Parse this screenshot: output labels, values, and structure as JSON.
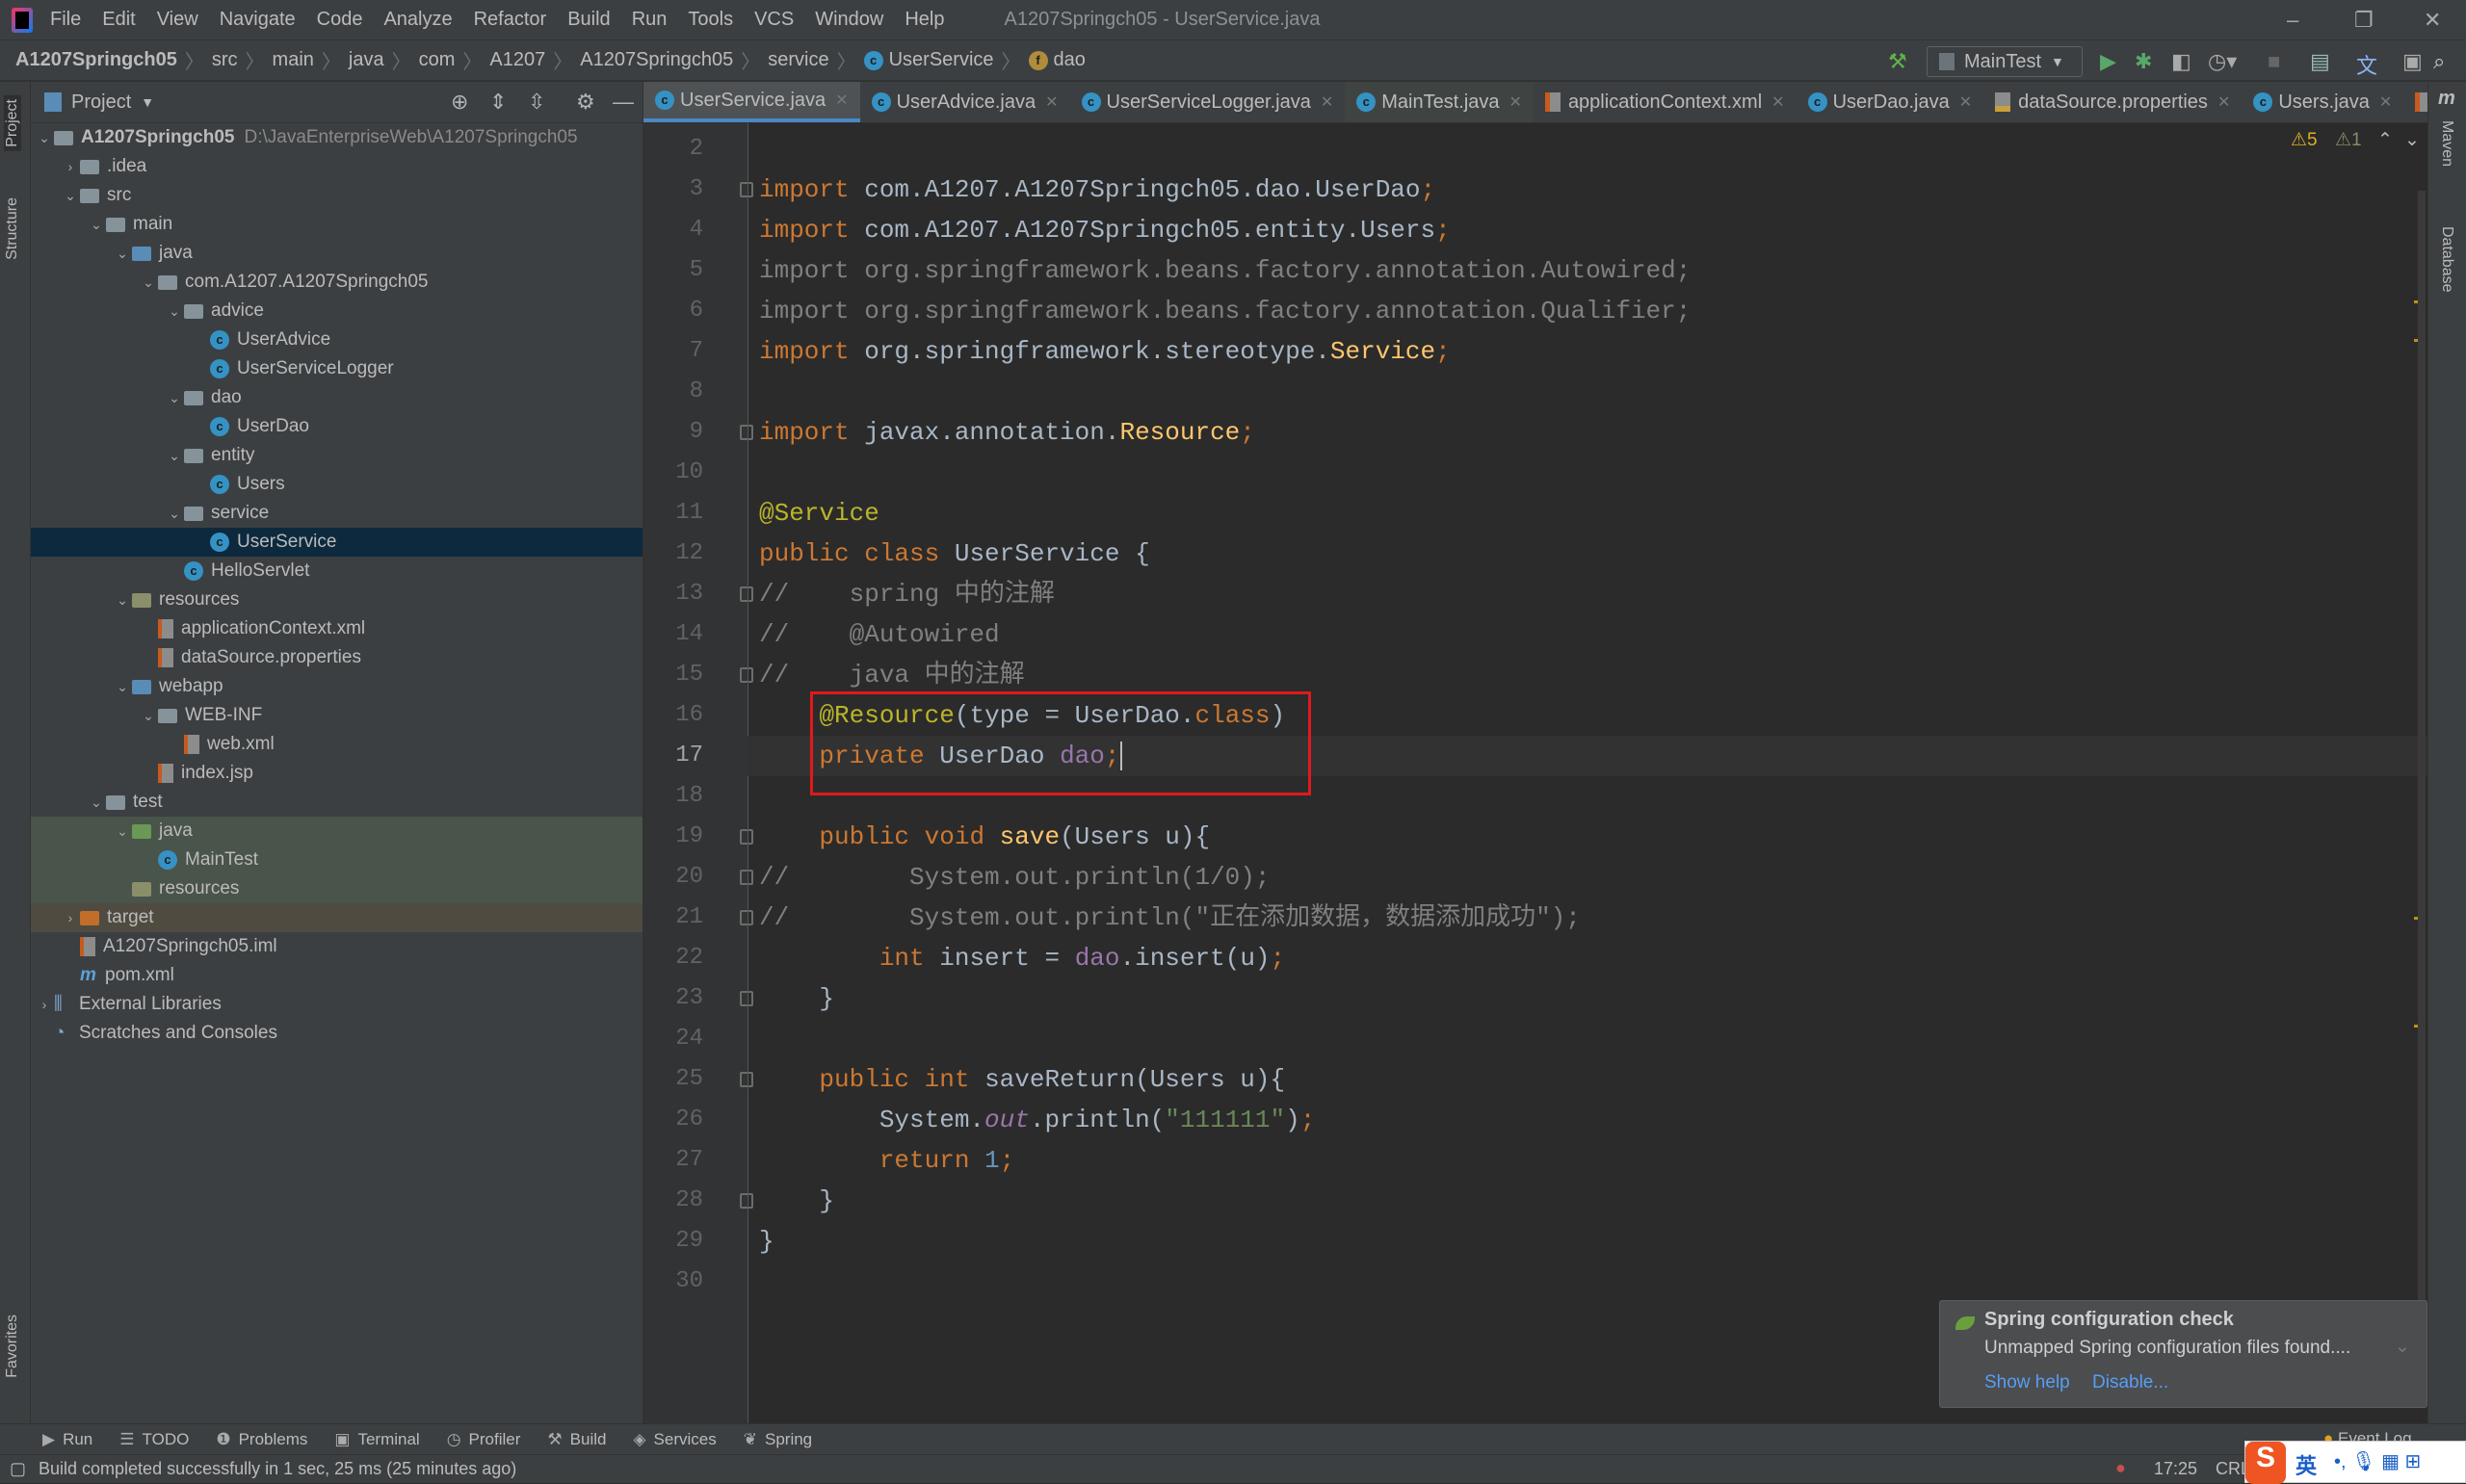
{
  "menubar": {
    "items": [
      "File",
      "Edit",
      "View",
      "Navigate",
      "Code",
      "Analyze",
      "Refactor",
      "Build",
      "Run",
      "Tools",
      "VCS",
      "Window",
      "Help"
    ],
    "title": "A1207Springch05 - UserService.java"
  },
  "navbar": {
    "crumbs": [
      "A1207Springch05",
      "src",
      "main",
      "java",
      "com",
      "A1207",
      "A1207Springch05",
      "service",
      "UserService",
      "dao"
    ],
    "run_config": "MainTest"
  },
  "project": {
    "title": "Project",
    "tree": [
      {
        "label": "A1207Springch05",
        "path": "D:\\JavaEnterpriseWeb\\A1207Springch05",
        "depth": 0,
        "arrow": "v",
        "icon": "folder"
      },
      {
        "label": ".idea",
        "depth": 1,
        "arrow": ">",
        "icon": "folder"
      },
      {
        "label": "src",
        "depth": 1,
        "arrow": "v",
        "icon": "folder"
      },
      {
        "label": "main",
        "depth": 2,
        "arrow": "v",
        "icon": "folder"
      },
      {
        "label": "java",
        "depth": 3,
        "arrow": "v",
        "icon": "folder-blue"
      },
      {
        "label": "com.A1207.A1207Springch05",
        "depth": 4,
        "arrow": "v",
        "icon": "package"
      },
      {
        "label": "advice",
        "depth": 5,
        "arrow": "v",
        "icon": "package"
      },
      {
        "label": "UserAdvice",
        "depth": 6,
        "icon": "class"
      },
      {
        "label": "UserServiceLogger",
        "depth": 6,
        "icon": "class"
      },
      {
        "label": "dao",
        "depth": 5,
        "arrow": "v",
        "icon": "package"
      },
      {
        "label": "UserDao",
        "depth": 6,
        "icon": "class"
      },
      {
        "label": "entity",
        "depth": 5,
        "arrow": "v",
        "icon": "package"
      },
      {
        "label": "Users",
        "depth": 6,
        "icon": "class"
      },
      {
        "label": "service",
        "depth": 5,
        "arrow": "v",
        "icon": "package"
      },
      {
        "label": "UserService",
        "depth": 6,
        "icon": "class",
        "selected": true
      },
      {
        "label": "HelloServlet",
        "depth": 5,
        "icon": "class"
      },
      {
        "label": "resources",
        "depth": 3,
        "arrow": "v",
        "icon": "folder-res"
      },
      {
        "label": "applicationContext.xml",
        "depth": 4,
        "icon": "xml"
      },
      {
        "label": "dataSource.properties",
        "depth": 4,
        "icon": "xml"
      },
      {
        "label": "webapp",
        "depth": 3,
        "arrow": "v",
        "icon": "folder-blue"
      },
      {
        "label": "WEB-INF",
        "depth": 4,
        "arrow": "v",
        "icon": "folder"
      },
      {
        "label": "web.xml",
        "depth": 5,
        "icon": "xml"
      },
      {
        "label": "index.jsp",
        "depth": 4,
        "icon": "xml"
      },
      {
        "label": "test",
        "depth": 2,
        "arrow": "v",
        "icon": "folder"
      },
      {
        "label": "java",
        "depth": 3,
        "arrow": "v",
        "icon": "folder-green",
        "test": true
      },
      {
        "label": "MainTest",
        "depth": 4,
        "icon": "class",
        "test": true
      },
      {
        "label": "resources",
        "depth": 3,
        "icon": "folder-res",
        "test": true
      },
      {
        "label": "target",
        "depth": 1,
        "arrow": ">",
        "icon": "folder-orange",
        "excluded": true
      },
      {
        "label": "A1207Springch05.iml",
        "depth": 1,
        "icon": "xml"
      },
      {
        "label": "pom.xml",
        "depth": 1,
        "icon": "maven"
      },
      {
        "label": "External Libraries",
        "depth": 0,
        "arrow": ">",
        "icon": "lib"
      },
      {
        "label": "Scratches and Consoles",
        "depth": 0,
        "icon": "scratch"
      }
    ]
  },
  "tabs": [
    {
      "label": "UserService.java",
      "icon": "class",
      "active": true
    },
    {
      "label": "UserAdvice.java",
      "icon": "class"
    },
    {
      "label": "UserServiceLogger.java",
      "icon": "class"
    },
    {
      "label": "MainTest.java",
      "icon": "class",
      "hl": true
    },
    {
      "label": "applicationContext.xml",
      "icon": "xml"
    },
    {
      "label": "UserDao.java",
      "icon": "class"
    },
    {
      "label": "dataSource.properties",
      "icon": "properties"
    },
    {
      "label": "Users.java",
      "icon": "class"
    }
  ],
  "inspections": {
    "warnings": "5",
    "weak_warnings": "1"
  },
  "editor": {
    "current_line": 17,
    "lines": [
      {
        "n": 2,
        "t": []
      },
      {
        "n": 3,
        "fold": true,
        "t": [
          [
            "import ",
            "k"
          ],
          [
            "com.A1207.A1207Springch05.dao.UserDao",
            ""
          ],
          [
            ";",
            "k"
          ]
        ]
      },
      {
        "n": 4,
        "t": [
          [
            "import ",
            "k"
          ],
          [
            "com.A1207.A1207Springch05.entity.Users",
            ""
          ],
          [
            ";",
            "k"
          ]
        ]
      },
      {
        "n": 5,
        "t": [
          [
            "import org.springframework.beans.factory.annotation.Autowired;",
            "g"
          ]
        ]
      },
      {
        "n": 6,
        "t": [
          [
            "import org.springframework.beans.factory.annotation.Qualifier;",
            "g"
          ]
        ]
      },
      {
        "n": 7,
        "t": [
          [
            "import ",
            "k"
          ],
          [
            "org.springframework.stereotype.",
            ""
          ],
          [
            "Service",
            "m"
          ],
          [
            ";",
            "k"
          ]
        ]
      },
      {
        "n": 8,
        "t": []
      },
      {
        "n": 9,
        "fold": true,
        "t": [
          [
            "import ",
            "k"
          ],
          [
            "javax.annotation.",
            ""
          ],
          [
            "Resource",
            "m"
          ],
          [
            ";",
            "k"
          ]
        ]
      },
      {
        "n": 10,
        "t": []
      },
      {
        "n": 11,
        "t": [
          [
            "@Service",
            "a"
          ]
        ]
      },
      {
        "n": 12,
        "t": [
          [
            "public class ",
            "k"
          ],
          [
            "UserService {",
            ""
          ]
        ]
      },
      {
        "n": 13,
        "fold": true,
        "t": [
          [
            "//    spring 中的注解",
            "c"
          ]
        ]
      },
      {
        "n": 14,
        "t": [
          [
            "//    @Autowired",
            "c"
          ]
        ]
      },
      {
        "n": 15,
        "fold": true,
        "t": [
          [
            "//    java 中的注解",
            "c"
          ]
        ]
      },
      {
        "n": 16,
        "t": [
          [
            "    ",
            ""
          ],
          [
            "@Resource",
            "a"
          ],
          [
            "(type = UserDao.",
            ""
          ],
          [
            "class",
            "k"
          ],
          [
            ")",
            ""
          ]
        ]
      },
      {
        "n": 17,
        "t": [
          [
            "    ",
            ""
          ],
          [
            "private ",
            "k"
          ],
          [
            "UserDao ",
            ""
          ],
          [
            "dao",
            "f"
          ],
          [
            ";",
            "k"
          ]
        ],
        "caret": true
      },
      {
        "n": 18,
        "t": []
      },
      {
        "n": 19,
        "fold": true,
        "t": [
          [
            "    ",
            ""
          ],
          [
            "public void ",
            "k"
          ],
          [
            "save",
            "m"
          ],
          [
            "(Users u){",
            ""
          ]
        ]
      },
      {
        "n": 20,
        "fold": true,
        "t": [
          [
            "//        System.out.println(1/0);",
            "c"
          ]
        ]
      },
      {
        "n": 21,
        "fold": true,
        "t": [
          [
            "//        System.out.println(\"正在添加数据，数据添加成功\");",
            "c"
          ]
        ]
      },
      {
        "n": 22,
        "t": [
          [
            "        ",
            ""
          ],
          [
            "int ",
            "k"
          ],
          [
            "insert = ",
            ""
          ],
          [
            "dao",
            "f"
          ],
          [
            ".insert(u)",
            ""
          ],
          [
            ";",
            "k"
          ]
        ]
      },
      {
        "n": 23,
        "fold": true,
        "t": [
          [
            "    }",
            ""
          ]
        ]
      },
      {
        "n": 24,
        "t": []
      },
      {
        "n": 25,
        "fold": true,
        "t": [
          [
            "    ",
            ""
          ],
          [
            "public int ",
            "k"
          ],
          [
            "saveReturn(Users u){",
            ""
          ]
        ]
      },
      {
        "n": 26,
        "t": [
          [
            "        System.",
            ""
          ],
          [
            "out",
            "i"
          ],
          [
            ".println(",
            ""
          ],
          [
            "\"111111\"",
            "s"
          ],
          [
            ")",
            ""
          ],
          [
            ";",
            "k"
          ]
        ]
      },
      {
        "n": 27,
        "t": [
          [
            "        ",
            ""
          ],
          [
            "return ",
            "k"
          ],
          [
            "1",
            "n"
          ],
          [
            ";",
            "k"
          ]
        ]
      },
      {
        "n": 28,
        "fold": true,
        "t": [
          [
            "    }",
            ""
          ]
        ]
      },
      {
        "n": 29,
        "t": [
          [
            "}",
            ""
          ]
        ]
      },
      {
        "n": 30,
        "t": []
      }
    ]
  },
  "notification": {
    "title": "Spring configuration check",
    "body": "Unmapped Spring configuration files found....",
    "show_help": "Show help",
    "disable": "Disable..."
  },
  "side_labels": {
    "project": "Project",
    "structure": "Structure",
    "favorites": "Favorites",
    "maven": "Maven",
    "database": "Database"
  },
  "bottom_tools": [
    "Run",
    "TODO",
    "Problems",
    "Terminal",
    "Profiler",
    "Build",
    "Services",
    "Spring"
  ],
  "event_log": "Event Log",
  "status": {
    "message": "Build completed successfully in 1 sec, 25 ms (25 minutes ago)",
    "position": "17:25",
    "line_sep": "CRLF"
  },
  "ime": {
    "label": "英"
  },
  "colors": {
    "accent": "#4a88c7",
    "highlight_box": "#e0191e",
    "keyword": "#cc7832",
    "annotation": "#bbb529"
  }
}
